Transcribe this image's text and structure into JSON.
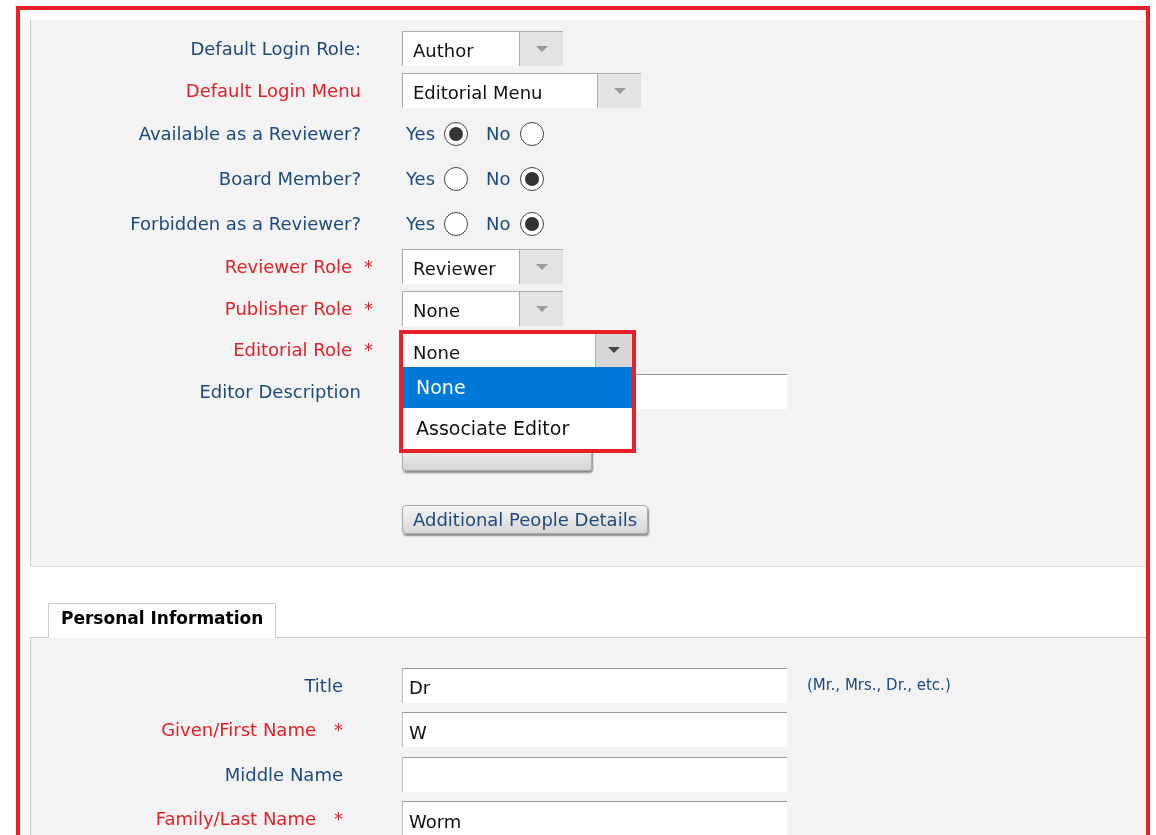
{
  "role_form": {
    "rows": [
      {
        "kind": "select",
        "label": "Default Login Role:",
        "required": false,
        "value": "Author",
        "wide": false
      },
      {
        "kind": "select",
        "label": "Default Login Menu",
        "required": true,
        "value": "Editorial Menu",
        "wide": true
      },
      {
        "kind": "radio",
        "label": "Available as a Reviewer?",
        "required": false,
        "options": [
          {
            "label": "Yes",
            "selected": true
          },
          {
            "label": "No",
            "selected": false
          }
        ]
      },
      {
        "kind": "radio",
        "label": "Board Member?",
        "required": false,
        "options": [
          {
            "label": "Yes",
            "selected": false
          },
          {
            "label": "No",
            "selected": true
          }
        ]
      },
      {
        "kind": "radio",
        "label": "Forbidden as a Reviewer?",
        "required": false,
        "options": [
          {
            "label": "Yes",
            "selected": false
          },
          {
            "label": "No",
            "selected": true
          }
        ]
      },
      {
        "kind": "select",
        "label": "Reviewer Role",
        "required": true,
        "mark": "*",
        "value": "Reviewer",
        "wide": false
      },
      {
        "kind": "select",
        "label": "Publisher Role",
        "required": true,
        "mark": "*",
        "value": "None",
        "wide": false
      },
      {
        "kind": "select",
        "label": "Editorial Role",
        "required": true,
        "mark": "*",
        "value": "None",
        "expanded": true,
        "options": [
          {
            "label": "None",
            "selected": true
          },
          {
            "label": "Associate Editor",
            "selected": false
          }
        ]
      },
      {
        "kind": "text",
        "label": "Editor Description",
        "required": false
      }
    ],
    "buttons": [
      "Additional People Details"
    ]
  },
  "personal_information": {
    "tab": "Personal Information",
    "rows": [
      {
        "label": "Title",
        "required": false,
        "value": "Dr",
        "hint": "(Mr., Mrs., Dr., etc.)"
      },
      {
        "label": "Given/First Name",
        "required": true,
        "mark": "*",
        "value": "W"
      },
      {
        "label": "Middle Name",
        "required": false
      },
      {
        "label": "Family/Last Name",
        "required": true,
        "mark": "*",
        "value": "Worm"
      }
    ]
  }
}
